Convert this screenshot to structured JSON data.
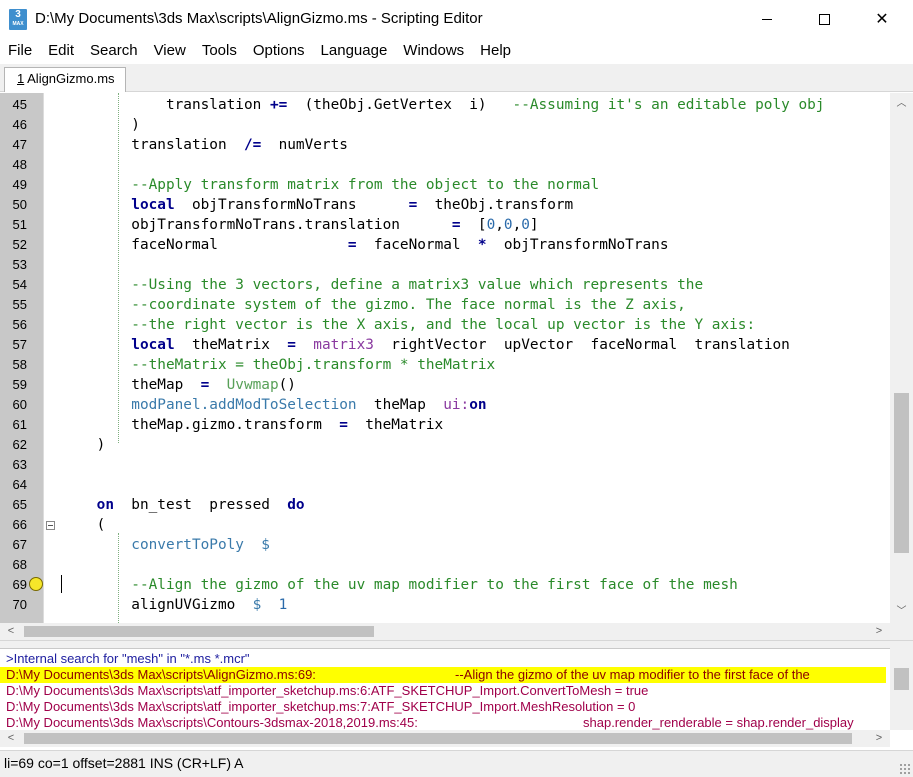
{
  "window": {
    "title": "D:\\My Documents\\3ds Max\\scripts\\AlignGizmo.ms - Scripting Editor",
    "icon_text": "3",
    "icon_sub": "MAX",
    "minimize_icon": "minimize-icon",
    "maximize_icon": "maximize-icon",
    "close_symbol": "✕"
  },
  "menu": [
    "File",
    "Edit",
    "Search",
    "View",
    "Tools",
    "Options",
    "Language",
    "Windows",
    "Help"
  ],
  "tab": {
    "number": "1",
    "label": " AlignGizmo.ms"
  },
  "editor": {
    "lines": [
      {
        "n": "45",
        "segs": [
          [
            "",
            "            translation "
          ],
          [
            "kw",
            "+="
          ],
          [
            "",
            "  (theObj.GetVertex  i)   "
          ],
          [
            "cm",
            "--Assuming it's an editable poly obj"
          ]
        ]
      },
      {
        "n": "46",
        "segs": [
          [
            "",
            "        )"
          ]
        ]
      },
      {
        "n": "47",
        "segs": [
          [
            "",
            "        translation  "
          ],
          [
            "kw",
            "/="
          ],
          [
            "",
            "  numVerts"
          ]
        ]
      },
      {
        "n": "48",
        "segs": [
          [
            "",
            ""
          ]
        ]
      },
      {
        "n": "49",
        "segs": [
          [
            "cm",
            "        --Apply transform matrix from the object to the normal"
          ]
        ]
      },
      {
        "n": "50",
        "segs": [
          [
            "kw",
            "        local"
          ],
          [
            "",
            "  objTransformNoTrans      "
          ],
          [
            "kw",
            "="
          ],
          [
            "",
            "  theObj.transform"
          ]
        ]
      },
      {
        "n": "51",
        "segs": [
          [
            "",
            "        objTransformNoTrans.translation      "
          ],
          [
            "kw",
            "="
          ],
          [
            "",
            "  ["
          ],
          [
            "nm",
            "0"
          ],
          [
            "",
            ","
          ],
          [
            "nm",
            "0"
          ],
          [
            "",
            ","
          ],
          [
            "nm",
            "0"
          ],
          [
            "",
            "]"
          ]
        ]
      },
      {
        "n": "52",
        "segs": [
          [
            "",
            "        faceNormal               "
          ],
          [
            "kw",
            "="
          ],
          [
            "",
            "  faceNormal  "
          ],
          [
            "kw",
            "*"
          ],
          [
            "",
            "  objTransformNoTrans"
          ]
        ]
      },
      {
        "n": "53",
        "segs": [
          [
            "",
            ""
          ]
        ]
      },
      {
        "n": "54",
        "segs": [
          [
            "cm",
            "        --Using the 3 vectors, define a matrix3 value which represents the"
          ]
        ]
      },
      {
        "n": "55",
        "segs": [
          [
            "cm",
            "        --coordinate system of the gizmo. The face normal is the Z axis,"
          ]
        ]
      },
      {
        "n": "56",
        "segs": [
          [
            "cm",
            "        --the right vector is the X axis, and the local up vector is the Y axis:"
          ]
        ]
      },
      {
        "n": "57",
        "segs": [
          [
            "kw",
            "        local"
          ],
          [
            "",
            "  theMatrix  "
          ],
          [
            "kw",
            "="
          ],
          [
            "",
            "  "
          ],
          [
            "pu",
            "matrix3"
          ],
          [
            "",
            "  rightVector  upVector  faceNormal  translation"
          ]
        ]
      },
      {
        "n": "58",
        "segs": [
          [
            "cm",
            "        --theMatrix = theObj.transform * theMatrix"
          ]
        ]
      },
      {
        "n": "59",
        "segs": [
          [
            "",
            "        theMap  "
          ],
          [
            "kw",
            "="
          ],
          [
            "",
            "  "
          ],
          [
            "gr",
            "Uvwmap"
          ],
          [
            "",
            "()"
          ]
        ]
      },
      {
        "n": "60",
        "segs": [
          [
            "fn",
            "        modPanel.addModToSelection"
          ],
          [
            "",
            "  theMap  "
          ],
          [
            "pu",
            "ui:"
          ],
          [
            "kw",
            "on"
          ]
        ]
      },
      {
        "n": "61",
        "segs": [
          [
            "",
            "        theMap.gizmo.transform  "
          ],
          [
            "kw",
            "="
          ],
          [
            "",
            "  theMatrix"
          ]
        ]
      },
      {
        "n": "62",
        "segs": [
          [
            "",
            "    )"
          ]
        ]
      },
      {
        "n": "63",
        "segs": [
          [
            "",
            ""
          ]
        ]
      },
      {
        "n": "64",
        "segs": [
          [
            "",
            ""
          ]
        ]
      },
      {
        "n": "65",
        "segs": [
          [
            "kw",
            "    on"
          ],
          [
            "",
            "  bn_test  pressed  "
          ],
          [
            "kw",
            "do"
          ]
        ]
      },
      {
        "n": "66",
        "segs": [
          [
            "",
            "    ("
          ]
        ]
      },
      {
        "n": "67",
        "segs": [
          [
            "fn",
            "        convertToPoly"
          ],
          [
            "",
            "  "
          ],
          [
            "fn",
            "$"
          ]
        ]
      },
      {
        "n": "68",
        "segs": [
          [
            "",
            ""
          ]
        ]
      },
      {
        "n": "69",
        "segs": [
          [
            "cm",
            "        --Align the gizmo of the uv map modifier to the first face of the mesh"
          ]
        ]
      },
      {
        "n": "70",
        "segs": [
          [
            "",
            "        alignUVGizmo  "
          ],
          [
            "fn",
            "$"
          ],
          [
            "",
            "  "
          ],
          [
            "nm",
            "1"
          ]
        ]
      }
    ]
  },
  "output": {
    "header": ">Internal search for \"mesh\" in \"*.ms *.mcr\"",
    "results": [
      {
        "file": "D:\\My Documents\\3ds Max\\scripts\\AlignGizmo.ms:69:",
        "text": "--Align the gizmo of the uv map modifier to the first face of the",
        "highlight": true
      },
      {
        "file": "D:\\My Documents\\3ds Max\\scripts\\atf_importer_sketchup.ms:6:ATF_SKETCHUP_Import.ConvertToMesh = true",
        "text": "",
        "highlight": false
      },
      {
        "file": "D:\\My Documents\\3ds Max\\scripts\\atf_importer_sketchup.ms:7:ATF_SKETCHUP_Import.MeshResolution = 0",
        "text": "",
        "highlight": false
      },
      {
        "file": "D:\\My Documents\\3ds Max\\scripts\\Contours-3dsmax-2018,2019.ms:45:",
        "text": "shap.render_renderable = shap.render_display",
        "highlight": false
      }
    ]
  },
  "status": {
    "text": "li=69 co=1 offset=2881 INS (CR+LF) A"
  },
  "colors": {
    "highlight_bg": "#ffff00",
    "keyword": "#00008b",
    "comment": "#2a8a2a",
    "gutter": "#c8c8c8"
  }
}
